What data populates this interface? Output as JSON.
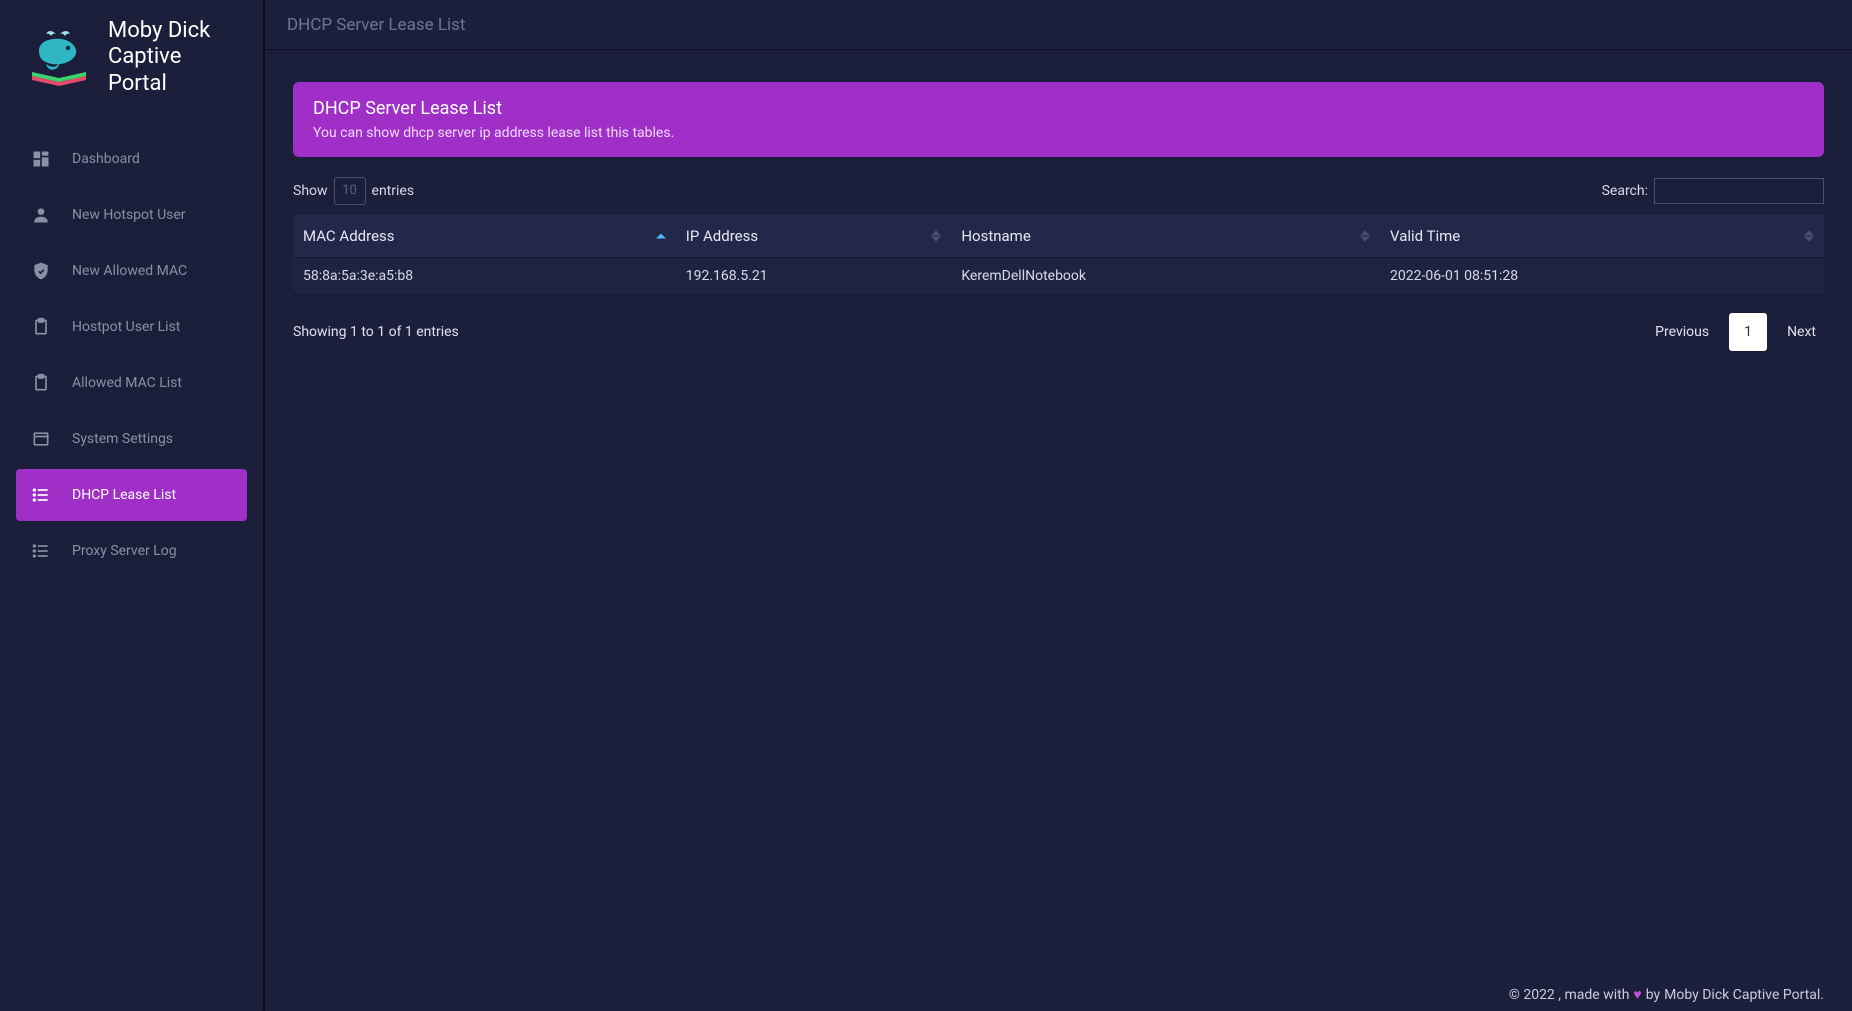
{
  "brand": {
    "line1": "Moby Dick",
    "line2": "Captive Portal"
  },
  "sidebar": {
    "items": [
      {
        "label": "Dashboard",
        "icon": "dashboard-icon",
        "active": false
      },
      {
        "label": "New Hotspot User",
        "icon": "user-icon",
        "active": false
      },
      {
        "label": "New Allowed MAC",
        "icon": "shield-icon",
        "active": false
      },
      {
        "label": "Hostpot User List",
        "icon": "clipboard-icon",
        "active": false
      },
      {
        "label": "Allowed MAC List",
        "icon": "clipboard-icon",
        "active": false
      },
      {
        "label": "System Settings",
        "icon": "settings-icon",
        "active": false
      },
      {
        "label": "DHCP Lease List",
        "icon": "list-icon",
        "active": true
      },
      {
        "label": "Proxy Server Log",
        "icon": "list-icon",
        "active": false
      }
    ]
  },
  "topbar": {
    "title": "DHCP Server Lease List"
  },
  "alert": {
    "title": "DHCP Server Lease List",
    "text": "You can show dhcp server ip address lease list this tables."
  },
  "table": {
    "show_label_pre": "Show",
    "show_value": "10",
    "show_label_post": "entries",
    "search_label": "Search:",
    "columns": [
      {
        "label": "MAC Address",
        "sort": "asc"
      },
      {
        "label": "IP Address",
        "sort": "both"
      },
      {
        "label": "Hostname",
        "sort": "both"
      },
      {
        "label": "Valid Time",
        "sort": "both"
      }
    ],
    "rows": [
      {
        "mac": "58:8a:5a:3e:a5:b8",
        "ip": "192.168.5.21",
        "hostname": "KeremDellNotebook",
        "valid_time": "2022-06-01 08:51:28"
      }
    ],
    "info": "Showing 1 to 1 of 1 entries",
    "pagination": {
      "prev": "Previous",
      "next": "Next",
      "current": "1"
    }
  },
  "footer": {
    "copyright": "© 2022 , made with ",
    "by_text": " by ",
    "link_text": "Moby Dick Captive Portal.",
    "heart": "♥"
  },
  "colors": {
    "accent": "#a02fc7"
  }
}
